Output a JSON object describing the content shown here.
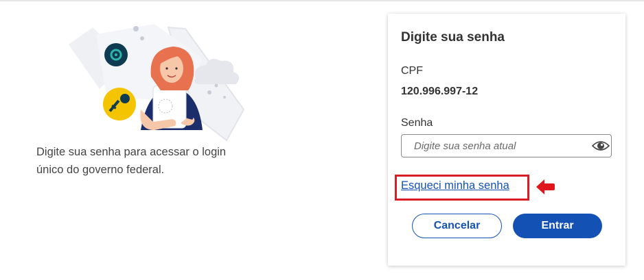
{
  "intro": {
    "line1": "Digite sua senha para acessar o login",
    "line2": "único do governo federal."
  },
  "card": {
    "title": "Digite sua senha",
    "cpf_label": "CPF",
    "cpf_value": "120.996.997-12",
    "password_label": "Senha",
    "password_placeholder": "Digite sua senha atual",
    "password_toggle_icon": "eye-icon",
    "forgot_link": "Esqueci minha senha",
    "cancel_button": "Cancelar",
    "enter_button": "Entrar"
  },
  "annotation": {
    "highlight_color": "#d91c26",
    "arrow_icon": "left-arrow-icon"
  },
  "colors": {
    "primary": "#1351b4",
    "accent_yellow": "#f5c400",
    "hair": "#e8714f"
  }
}
